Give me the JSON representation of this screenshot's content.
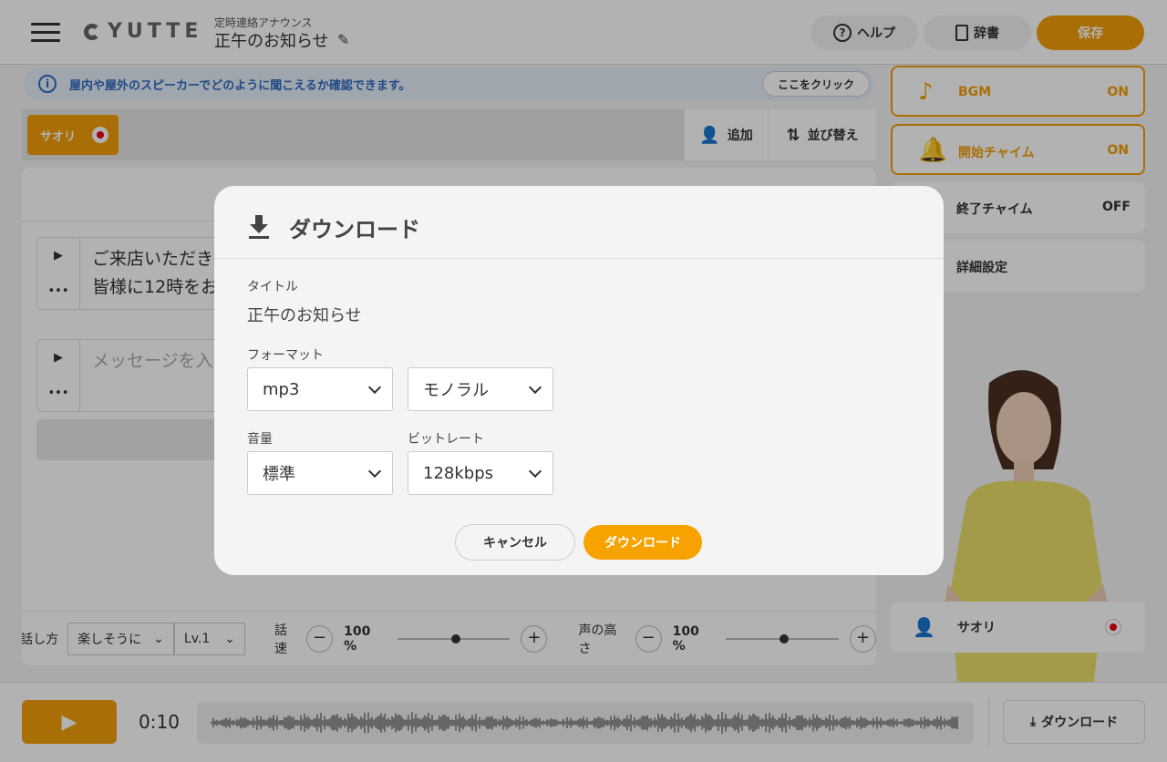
{
  "header": {
    "logo": "YUTTE",
    "category": "定時連絡アナウンス",
    "title": "正午のお知らせ",
    "help_label": "ヘルプ",
    "dictionary_label": "辞書",
    "save_label": "保存"
  },
  "banner": {
    "text": "屋内や屋外のスピーカーでどのように聞こえるか確認できます。",
    "button_label": "ここをクリック"
  },
  "speakers": {
    "tag": "サオリ",
    "add_label": "追加",
    "sort_label": "並び替え"
  },
  "editor": {
    "blocks": [
      {
        "line1": "ご来店いただき",
        "line2": "皆様に12時をお"
      },
      {
        "placeholder": "メッセージを入"
      }
    ],
    "controls": {
      "style_label": "話し方",
      "style_value": "楽しそうに",
      "level_value": "Lv.1",
      "speed_label": "話速",
      "speed_value": "100 %",
      "speed_level": 0.5,
      "pitch_label": "声の高さ",
      "pitch_value": "100 %",
      "pitch_level": 0.5
    }
  },
  "right_panel": {
    "bgm": {
      "label": "BGM",
      "value": "ON"
    },
    "start_chime": {
      "label": "開始チャイム",
      "value": "ON"
    },
    "end_chime": {
      "label": "終了チャイム",
      "value": "OFF"
    },
    "detail": {
      "label": "詳細設定"
    },
    "speaker_name": "サオリ"
  },
  "footer": {
    "time": "0:10",
    "download_label": "ダウンロード"
  },
  "modal": {
    "title": "ダウンロード",
    "title_label": "タイトル",
    "title_value": "正午のお知らせ",
    "format_label": "フォーマット",
    "format_value": "mp3",
    "channel_value": "モノラル",
    "volume_label": "音量",
    "volume_value": "標準",
    "bitrate_label": "ビットレート",
    "bitrate_value": "128kbps",
    "cancel_label": "キャンセル",
    "download_label": "ダウンロード"
  },
  "colors": {
    "accent": "#f49e0a",
    "info_blue": "#2f6bc2",
    "record_red": "#e60012"
  }
}
